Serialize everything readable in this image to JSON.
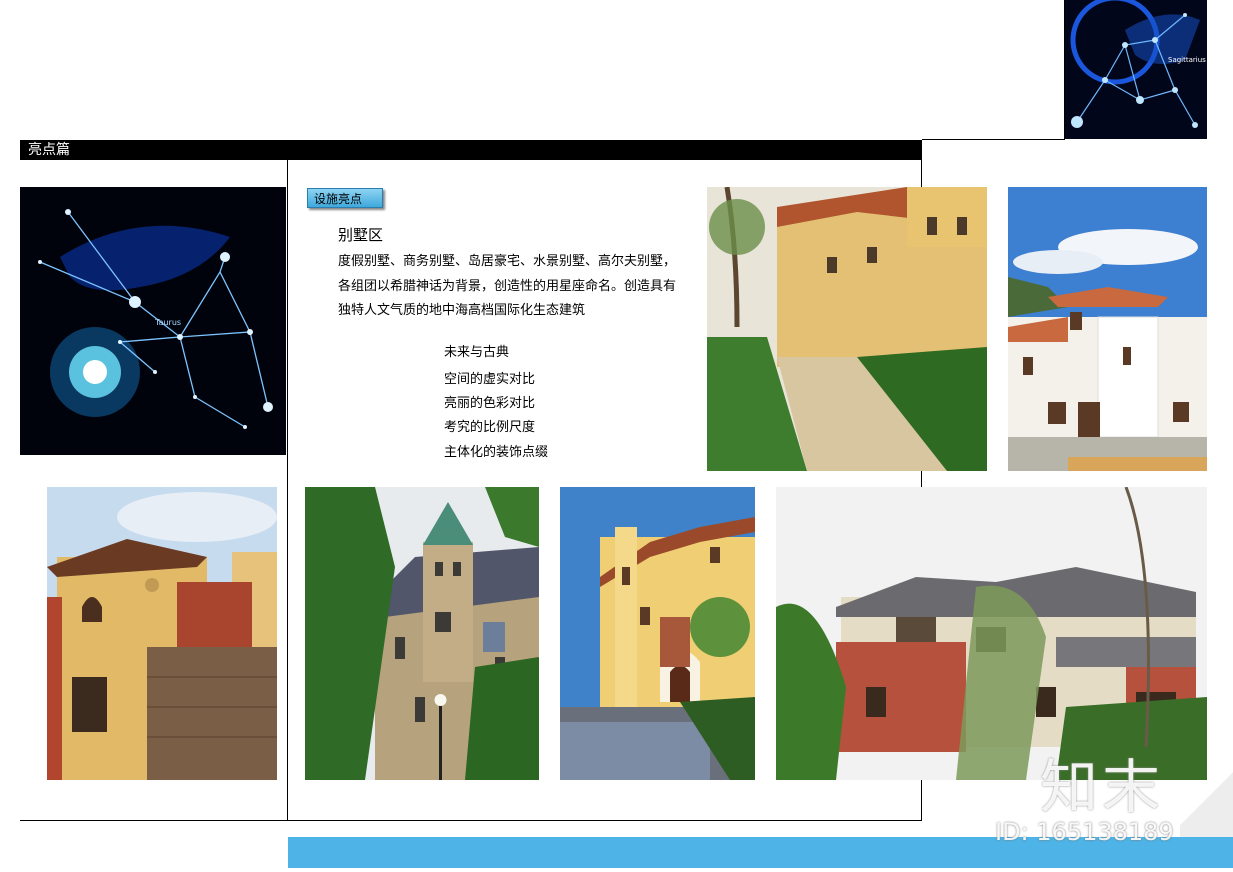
{
  "section": {
    "title": "亮点篇"
  },
  "tag": {
    "label": "设施亮点"
  },
  "villa": {
    "heading": "别墅区",
    "lines": [
      "度假别墅、商务别墅、岛居豪宅、水景别墅、高尔夫别墅，",
      "各组团以希腊神话为背景，创造性的用星座命名。创造具有",
      "独特人文气质的地中海高档国际化生态建筑"
    ]
  },
  "features": {
    "title": "未来与古典",
    "items": [
      "空间的虚实对比",
      "亮丽的色彩对比",
      "考究的比例尺度",
      "主体化的装饰点缀"
    ]
  },
  "constellations": {
    "top_right_label": "Sagittarius",
    "left_label": "Taurus"
  },
  "watermark": {
    "logo": "知末",
    "id": "ID: 165138189"
  },
  "colors": {
    "accent_blue": "#4eb3e6",
    "tag_blue": "#3fa9dc",
    "bar": "#000000"
  }
}
